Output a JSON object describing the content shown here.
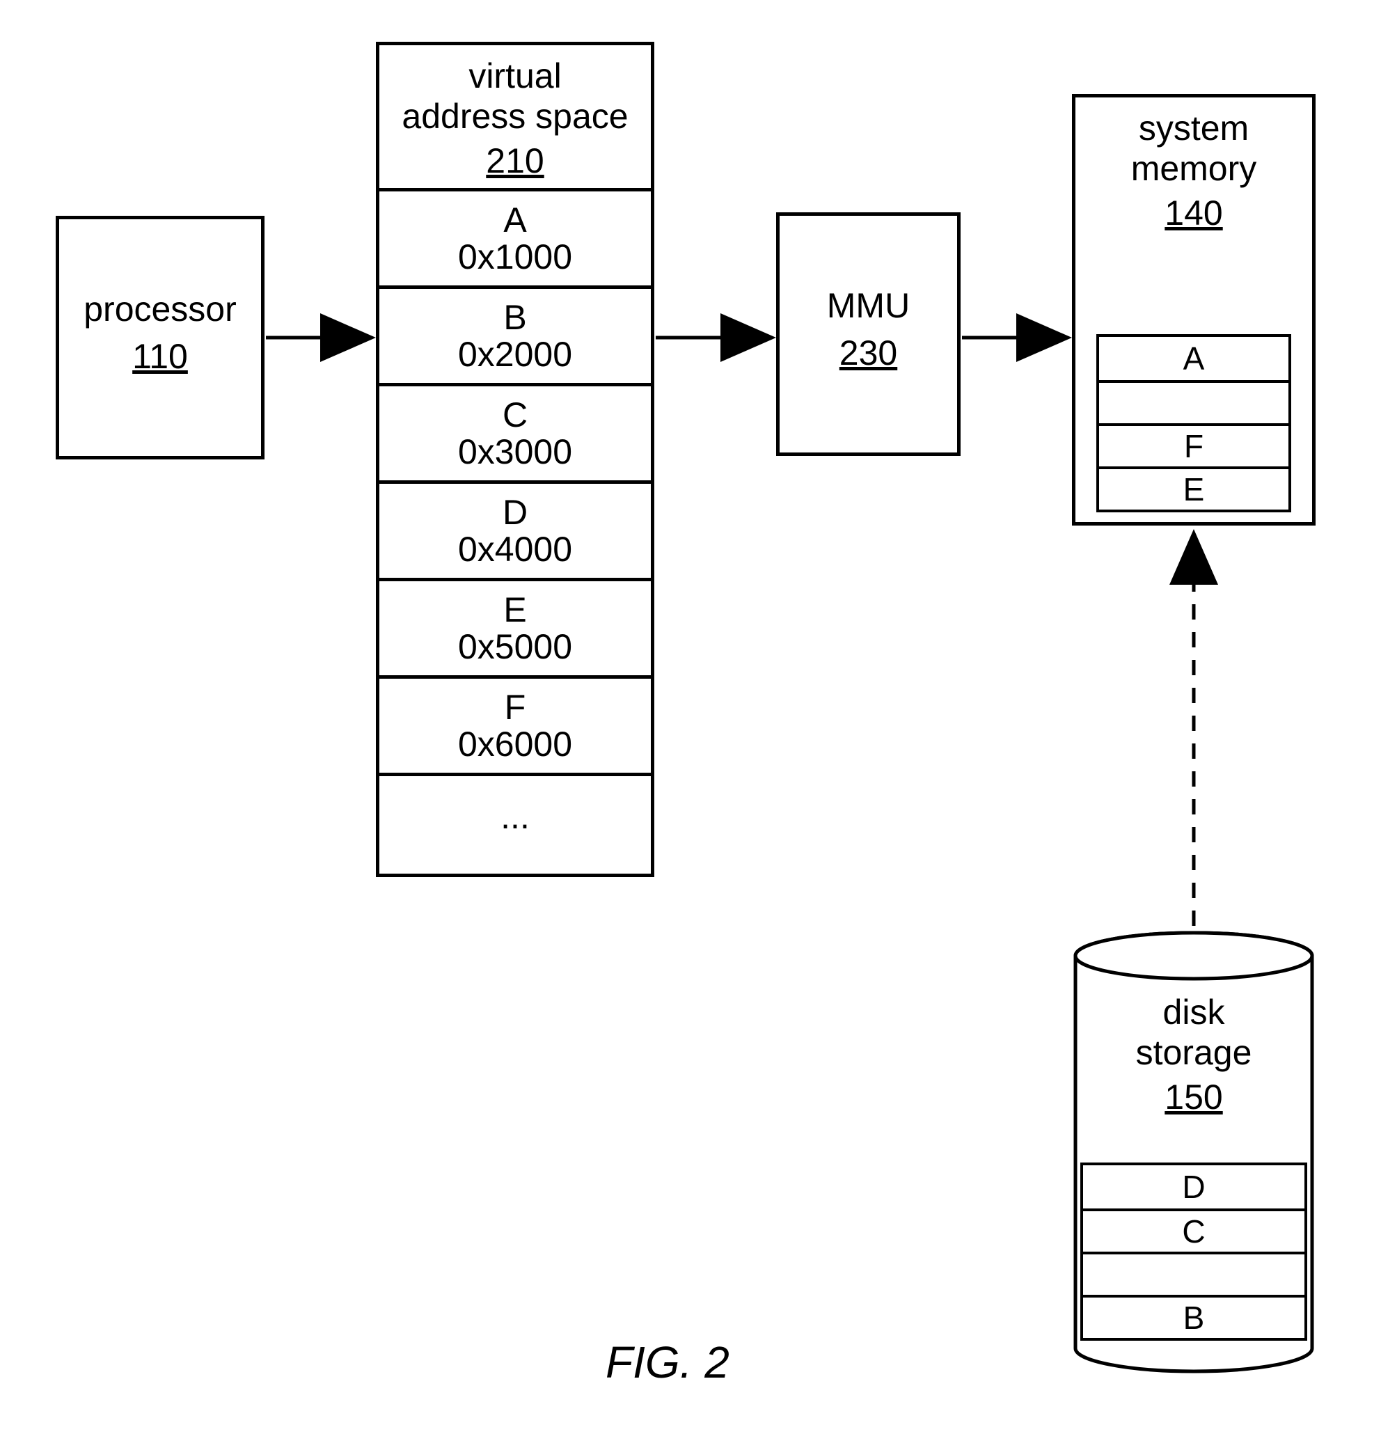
{
  "figure_label": "FIG. 2",
  "processor": {
    "title": "processor",
    "num": "110"
  },
  "vas": {
    "title": "virtual address space",
    "num": "210",
    "entries": [
      {
        "name": "A",
        "addr": "0x1000"
      },
      {
        "name": "B",
        "addr": "0x2000"
      },
      {
        "name": "C",
        "addr": "0x3000"
      },
      {
        "name": "D",
        "addr": "0x4000"
      },
      {
        "name": "E",
        "addr": "0x5000"
      },
      {
        "name": "F",
        "addr": "0x6000"
      }
    ],
    "ellipsis": "..."
  },
  "mmu": {
    "title": "MMU",
    "num": "230"
  },
  "sysmem": {
    "title": "system memory",
    "num": "140",
    "rows": [
      "A",
      "",
      "F",
      "E"
    ]
  },
  "disk": {
    "title": "disk storage",
    "num": "150",
    "rows": [
      "D",
      "C",
      "",
      "B"
    ]
  }
}
